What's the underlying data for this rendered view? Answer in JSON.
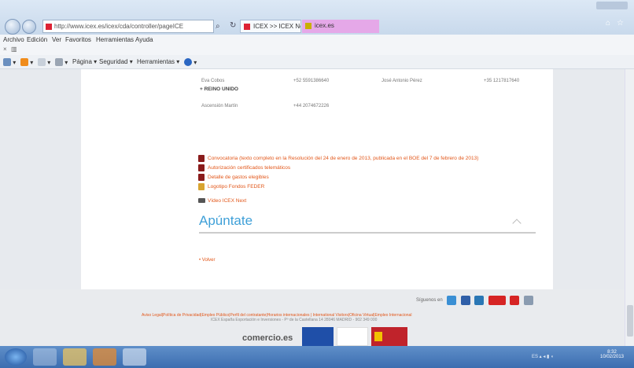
{
  "browser": {
    "address": "http://www.icex.es/icex/cda/controller/pageICE",
    "tabs": [
      "ICEX >> ICEX Next",
      "icex.es"
    ],
    "menu": [
      "Archivo",
      "Edición",
      "Ver",
      "Favoritos",
      "Herramientas",
      "Ayuda"
    ],
    "command_bar": [
      "Página",
      "Seguridad",
      "Herramientas"
    ]
  },
  "page": {
    "contacts": [
      {
        "name": "Eva Cobos",
        "phone": "+52 5591386640",
        "name2": "José Antonio Pérez",
        "phone2": "+35 1217817640"
      },
      {
        "name": "Ascensión Martín",
        "phone": "+44 2074672226"
      }
    ],
    "country": "REINO UNIDO",
    "links": [
      "Convocatoria (texto completo en la Resolución del 24 de enero de 2013, publicada en el BOE del 7 de febrero de 2013)",
      "Autorización certificados telemáticos",
      "Detalle de gastos elegibles",
      "Logotipo Fondos FEDER"
    ],
    "video_link": "Vídeo ICEX Next",
    "apuntate": "Apúntate",
    "volver": "Volver"
  },
  "footer": {
    "siguenos": "Síguenos en",
    "legal": "Aviso Legal|Política de Privacidad|Empleo Público|Perfil del contratante|Horarios internacionales | International Visitors|Oficina Virtual|Empleo Internacional",
    "address": "ICEX España Exportación e Inversiones - Pº de la Castellana 14 28046 MADRID - 902 349 000",
    "comercio": "comercio.es"
  },
  "taskbar": {
    "time": "8:32",
    "date": "10/02/2013"
  }
}
